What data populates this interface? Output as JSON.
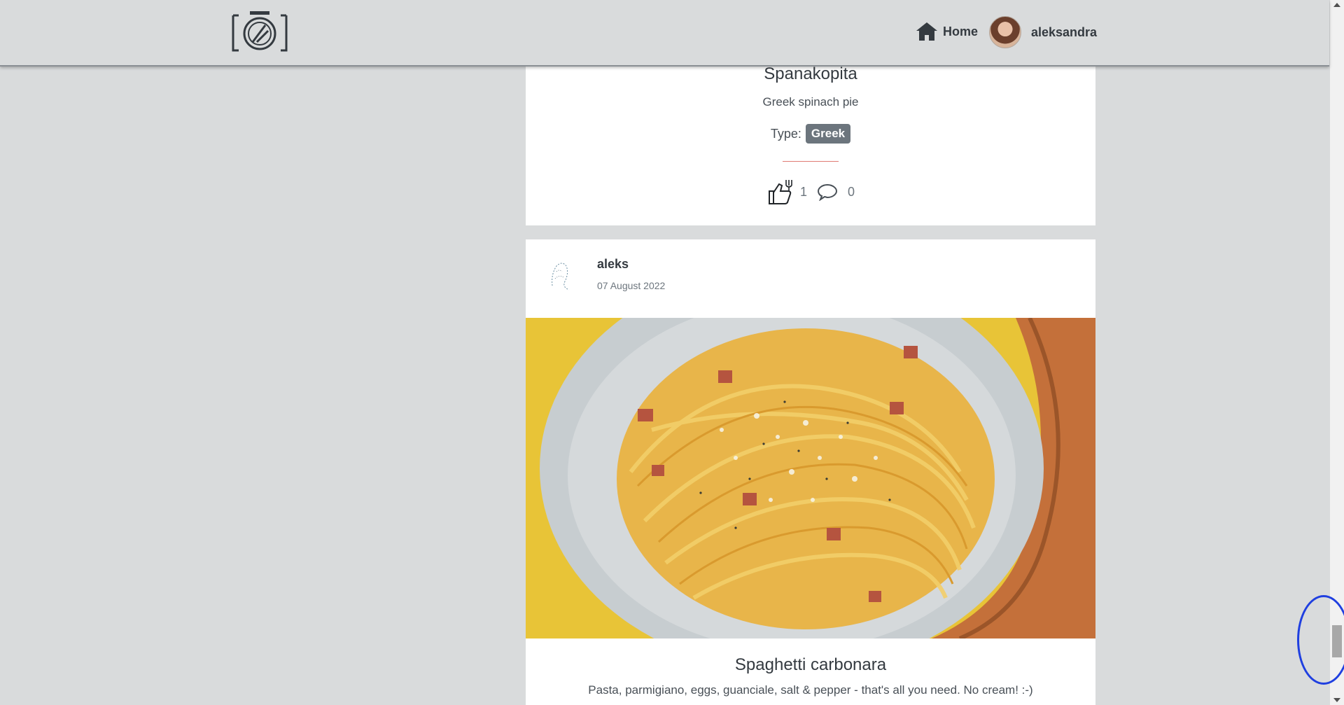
{
  "nav": {
    "logo_icon": "camera-plate-logo-icon",
    "home_label": "Home",
    "home_icon": "home-icon",
    "user_label": "aleksandra"
  },
  "posts": [
    {
      "title": "Spanakopita",
      "description": "Greek spinach pie",
      "type_label": "Type:",
      "type_value": "Greek",
      "likes": "1",
      "comments": "0"
    },
    {
      "author": "aleks",
      "date": "07 August 2022",
      "title": "Spaghetti carbonara",
      "description": "Pasta, parmigiano, eggs, guanciale, salt & pepper - that's all you need. No cream! :-)"
    }
  ],
  "colors": {
    "page_bg": "#d9dbdc",
    "card_bg": "#ffffff",
    "badge_bg": "#6c757d",
    "divider": "#e07a74",
    "annotation_ring": "#1f3fe0"
  }
}
